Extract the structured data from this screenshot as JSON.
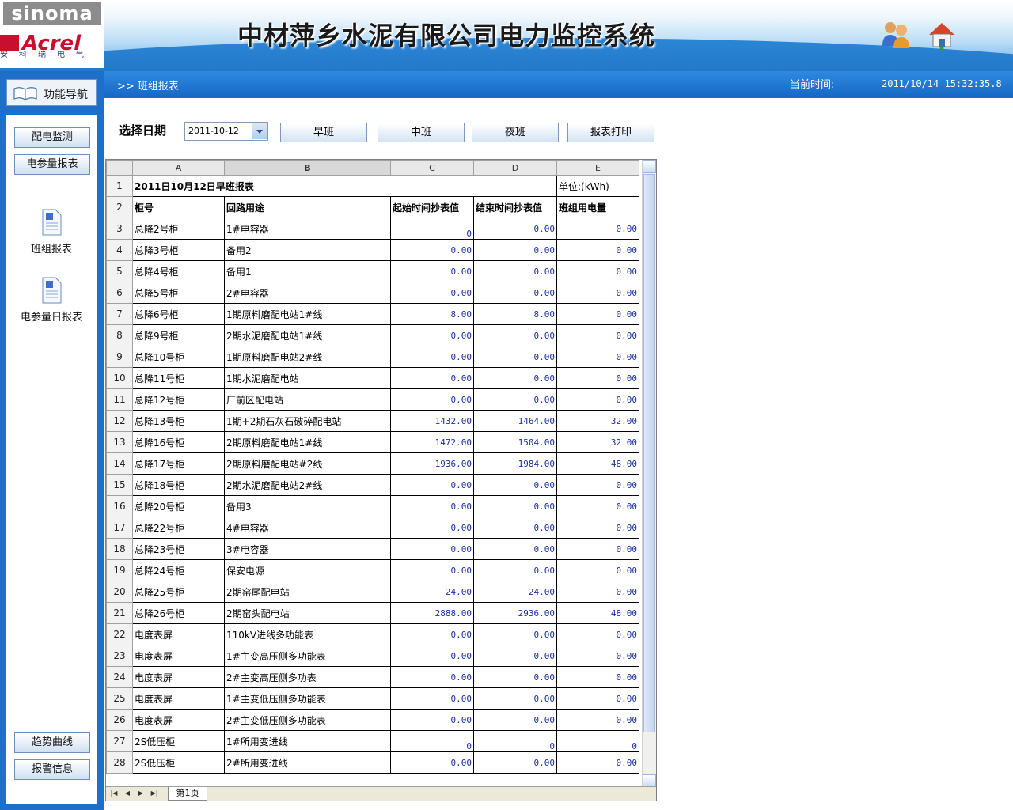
{
  "header": {
    "logo_top": "sinoma",
    "logo_brand": "Acrel",
    "logo_brand_sub": "安科瑞电气",
    "title": "中材萍乡水泥有限公司电力监控系统",
    "icons": [
      "users-icon",
      "home-icon"
    ]
  },
  "nav": {
    "breadcrumb": ">> 班组报表",
    "time_label": "当前时间:",
    "time_value": "2011/10/14 15:32:35.8"
  },
  "sidebar": {
    "title": "功能导航",
    "buttons": [
      "配电监测",
      "电参量报表"
    ],
    "docs": [
      "班组报表",
      "电参量日报表"
    ],
    "bottom_buttons": [
      "趋势曲线",
      "报警信息"
    ]
  },
  "controls": {
    "date_label": "选择日期",
    "date_value": "2011-10-12",
    "buttons": [
      "早班",
      "中班",
      "夜班",
      "报表打印"
    ]
  },
  "sheet": {
    "col_headers": [
      "A",
      "B",
      "C",
      "D",
      "E"
    ],
    "title": "2011日10月12日早班报表",
    "unit": "单位:(kWh)",
    "headers": [
      "柜号",
      "回路用途",
      "起始时间抄表值",
      "结束时间抄表值",
      "班组用电量"
    ],
    "rows": [
      [
        "总降2号柜",
        "1#电容器",
        "0",
        "0.00",
        "0.00"
      ],
      [
        "总降3号柜",
        "备用2",
        "0.00",
        "0.00",
        "0.00"
      ],
      [
        "总降4号柜",
        "备用1",
        "0.00",
        "0.00",
        "0.00"
      ],
      [
        "总降5号柜",
        "2#电容器",
        "0.00",
        "0.00",
        "0.00"
      ],
      [
        "总降6号柜",
        "1期原料磨配电站1#线",
        "8.00",
        "8.00",
        "0.00"
      ],
      [
        "总降9号柜",
        "2期水泥磨配电站1#线",
        "0.00",
        "0.00",
        "0.00"
      ],
      [
        "总降10号柜",
        "1期原料磨配电站2#线",
        "0.00",
        "0.00",
        "0.00"
      ],
      [
        "总降11号柜",
        "1期水泥磨配电站",
        "0.00",
        "0.00",
        "0.00"
      ],
      [
        "总降12号柜",
        "厂前区配电站",
        "0.00",
        "0.00",
        "0.00"
      ],
      [
        "总降13号柜",
        "1期+2期石灰石破碎配电站",
        "1432.00",
        "1464.00",
        "32.00"
      ],
      [
        "总降16号柜",
        "2期原料磨配电站1#线",
        "1472.00",
        "1504.00",
        "32.00"
      ],
      [
        "总降17号柜",
        "2期原料磨配电站#2线",
        "1936.00",
        "1984.00",
        "48.00"
      ],
      [
        "总降18号柜",
        "2期水泥磨配电站2#线",
        "0.00",
        "0.00",
        "0.00"
      ],
      [
        "总降20号柜",
        "备用3",
        "0.00",
        "0.00",
        "0.00"
      ],
      [
        "总降22号柜",
        "4#电容器",
        "0.00",
        "0.00",
        "0.00"
      ],
      [
        "总降23号柜",
        "3#电容器",
        "0.00",
        "0.00",
        "0.00"
      ],
      [
        "总降24号柜",
        "保安电源",
        "0.00",
        "0.00",
        "0.00"
      ],
      [
        "总降25号柜",
        "2期窑尾配电站",
        "24.00",
        "24.00",
        "0.00"
      ],
      [
        "总降26号柜",
        "2期窑头配电站",
        "2888.00",
        "2936.00",
        "48.00"
      ],
      [
        "电度表屏",
        "110kV进线多功能表",
        "0.00",
        "0.00",
        "0.00"
      ],
      [
        "电度表屏",
        "1#主变高压侧多功能表",
        "0.00",
        "0.00",
        "0.00"
      ],
      [
        "电度表屏",
        "2#主变高压侧多功表",
        "0.00",
        "0.00",
        "0.00"
      ],
      [
        "电度表屏",
        "1#主变低压侧多功能表",
        "0.00",
        "0.00",
        "0.00"
      ],
      [
        "电度表屏",
        "2#主变低压侧多功能表",
        "0.00",
        "0.00",
        "0.00"
      ],
      [
        "2S低压柜",
        "1#所用变进线",
        "0",
        "0",
        "0"
      ],
      [
        "2S低压柜",
        "2#所用变进线",
        "0.00",
        "0.00",
        "0.00"
      ]
    ],
    "tab_label": "第1页"
  }
}
